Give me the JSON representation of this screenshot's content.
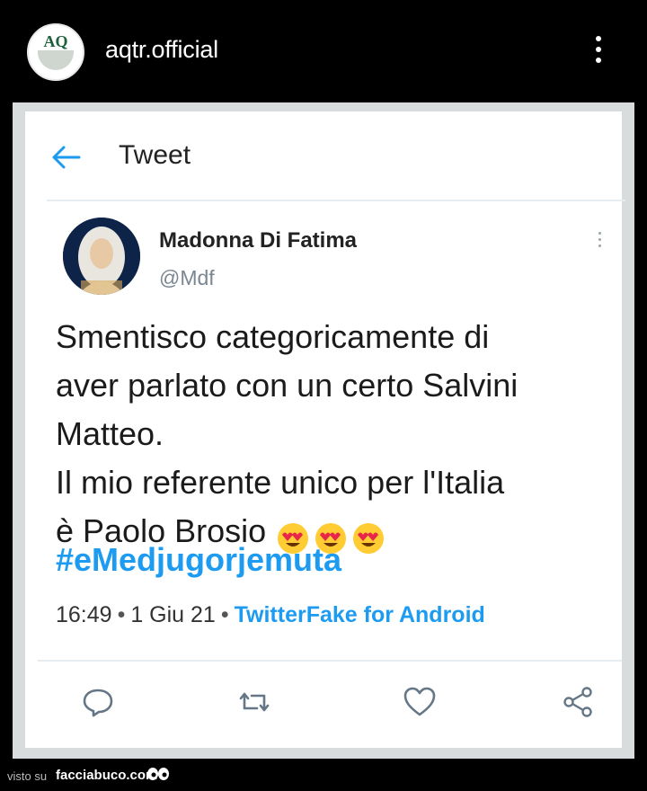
{
  "topbar": {
    "username": "aqtr.official",
    "avatar_icon": "aq-logo-icon"
  },
  "tweet_header": {
    "title": "Tweet",
    "back_icon": "back-arrow-icon"
  },
  "tweet": {
    "author_name": "Madonna Di Fatima",
    "author_handle": "@Mdf",
    "text_lines": [
      "Smentisco categoricamente di",
      "aver parlato con un certo Salvini",
      "Matteo.",
      "Il mio referente unico per l'Italia",
      "è Paolo Brosio"
    ],
    "emoji_icon": "heart-eyes-emoji-icon",
    "emoji_count": 3,
    "hashtag": "#eMedjugorjemuta",
    "time": "16:49",
    "date": "1 Giu 21",
    "source": "TwitterFake for Android",
    "separator": "•"
  },
  "actions": {
    "icons": [
      "reply-icon",
      "retweet-icon",
      "like-icon",
      "share-icon"
    ]
  },
  "footer": {
    "visto_su": "visto su",
    "brand": "facciabuco.com"
  },
  "colors": {
    "accent": "#1d9bf0",
    "topbar_bg": "#000000",
    "card_bg": "#ffffff",
    "handle": "#7a8691"
  }
}
